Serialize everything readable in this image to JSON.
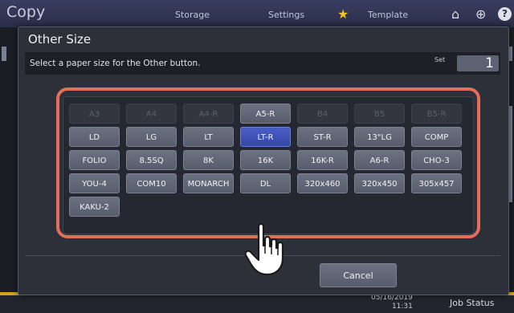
{
  "app": {
    "title": "Copy",
    "tabs": [
      "Storage",
      "Settings",
      "Template"
    ]
  },
  "dialog": {
    "title": "Other Size",
    "instruction": "Select a paper size for the Other button.",
    "set_label": "Set",
    "set_value": "1",
    "cancel_label": "Cancel"
  },
  "paper_sizes": {
    "rows": [
      [
        "A3",
        "A4",
        "A4-R",
        "A5-R",
        "B4",
        "B5",
        "B5-R"
      ],
      [
        "LD",
        "LG",
        "LT",
        "LT-R",
        "ST-R",
        "13\"LG",
        "COMP"
      ],
      [
        "FOLIO",
        "8.5SQ",
        "8K",
        "16K",
        "16K-R",
        "A6-R",
        "CHO-3"
      ],
      [
        "YOU-4",
        "COM10",
        "MONARCH",
        "DL",
        "320x460",
        "320x450",
        "305x457"
      ],
      [
        "KAKU-2"
      ]
    ],
    "disabled": [
      "A3",
      "A4",
      "A4-R",
      "B4",
      "B5",
      "B5-R"
    ],
    "selected": "LT-R"
  },
  "status": {
    "date": "05/16/2019",
    "time": "11:31",
    "job_status": "Job Status"
  },
  "colors": {
    "highlight": "#e36e5e",
    "selected": "#3f55be",
    "accent_bar": "#d0a41c"
  },
  "icons": [
    "star-icon",
    "home-icon",
    "globe-icon",
    "help-icon",
    "pointer-hand-icon"
  ]
}
